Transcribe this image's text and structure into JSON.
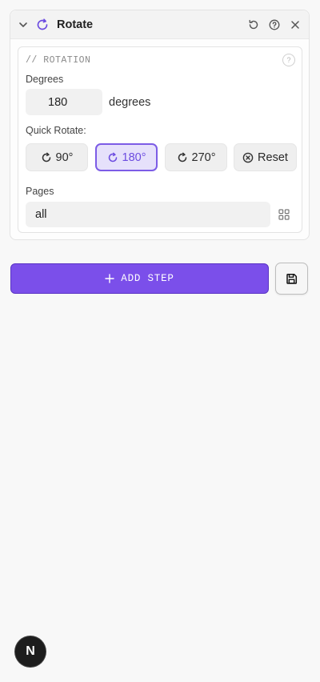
{
  "header": {
    "title": "Rotate",
    "icons": [
      "chevron-down-icon",
      "rotate-icon",
      "reset-icon",
      "help-icon",
      "close-icon"
    ]
  },
  "rotation": {
    "section_label": "// ROTATION",
    "help_mark": "?",
    "degrees_label": "Degrees",
    "degrees_value": "180",
    "degrees_unit": "degrees",
    "quick_label": "Quick Rotate:",
    "quick_buttons": [
      {
        "label": "90°",
        "icon": "rotate-cw-icon",
        "active": false
      },
      {
        "label": "180°",
        "icon": "rotate-cw-icon",
        "active": true
      },
      {
        "label": "270°",
        "icon": "rotate-cw-icon",
        "active": false
      },
      {
        "label": "Reset",
        "icon": "x-circle-icon",
        "active": false
      }
    ],
    "pages_label": "Pages",
    "pages_value": "all"
  },
  "actions": {
    "add_step_label": "ADD STEP",
    "save_icon": "save-icon"
  },
  "avatar": {
    "letter": "N"
  },
  "colors": {
    "accent": "#7b4fea",
    "active_bg": "#e6e1fb",
    "active_border": "#7c5ce6",
    "background": "#f8f8f8"
  }
}
